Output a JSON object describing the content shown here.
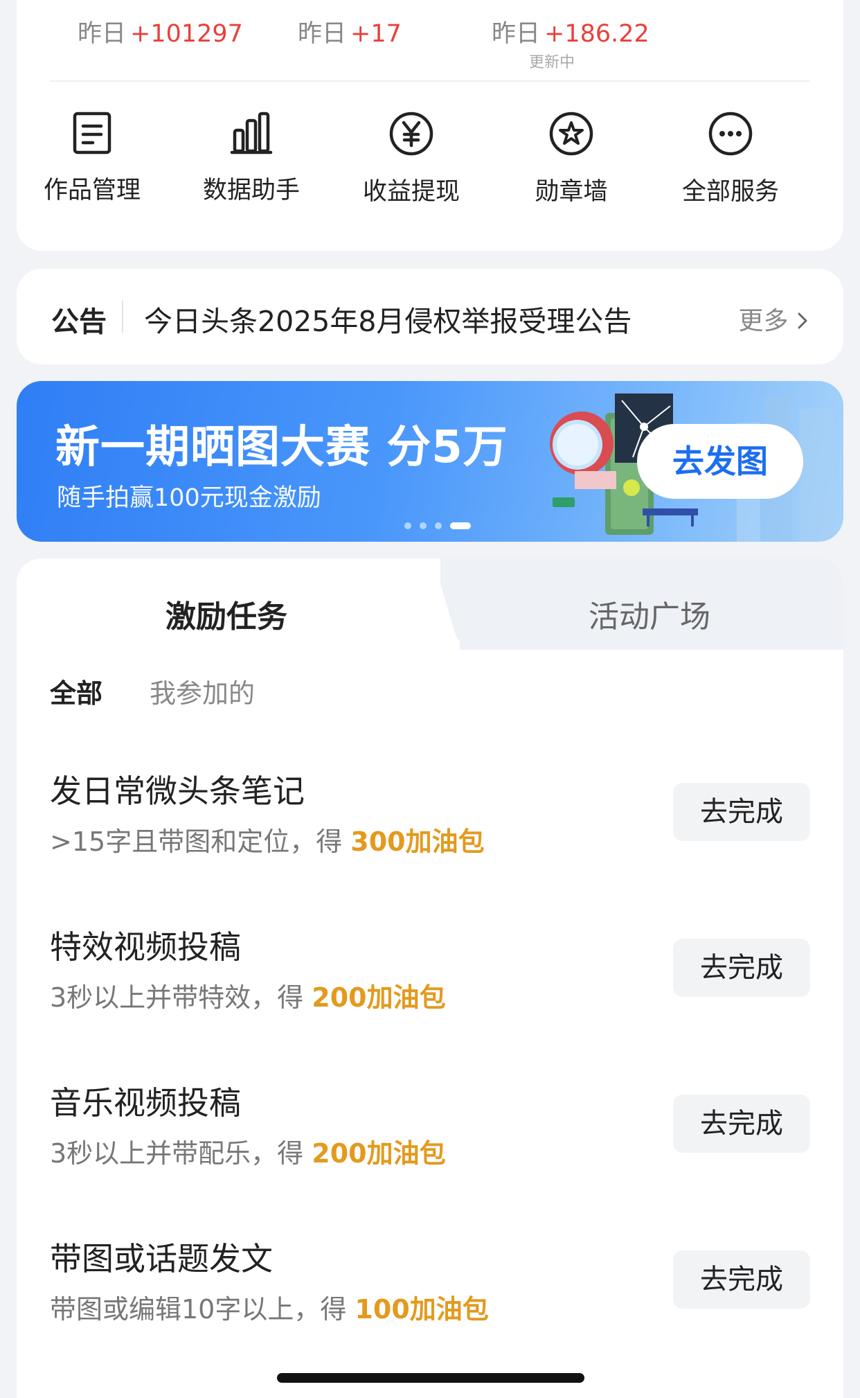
{
  "stats": [
    {
      "label": "昨日",
      "delta": "+101297",
      "note": ""
    },
    {
      "label": "昨日",
      "delta": "+17",
      "note": ""
    },
    {
      "label": "昨日",
      "delta": "+186.22",
      "note": "更新中"
    }
  ],
  "services": [
    {
      "label": "作品管理",
      "icon": "document-icon"
    },
    {
      "label": "数据助手",
      "icon": "bar-chart-icon"
    },
    {
      "label": "收益提现",
      "icon": "yen-icon"
    },
    {
      "label": "勋章墙",
      "icon": "medal-icon"
    },
    {
      "label": "全部服务",
      "icon": "more-icon"
    }
  ],
  "notice": {
    "tag": "公告",
    "text": "今日头条2025年8月侵权举报受理公告",
    "more": "更多"
  },
  "banner": {
    "title": "新一期晒图大赛 分5万",
    "subtitle": "随手拍赢100元现金激励",
    "cta": "去发图",
    "page_count": 4,
    "active_page": 4
  },
  "tabs": {
    "incentive": "激励任务",
    "square": "活动广场"
  },
  "filters": {
    "all": "全部",
    "mine": "我参加的"
  },
  "tasks": [
    {
      "title": "发日常微头条笔记",
      "desc": ">15字且带图和定位，得 ",
      "reward": "300加油包",
      "button": "去完成"
    },
    {
      "title": "特效视频投稿",
      "desc": "3秒以上并带特效，得 ",
      "reward": "200加油包",
      "button": "去完成"
    },
    {
      "title": "音乐视频投稿",
      "desc": "3秒以上并带配乐，得 ",
      "reward": "200加油包",
      "button": "去完成"
    },
    {
      "title": "带图或话题发文",
      "desc": "带图或编辑10字以上，得 ",
      "reward": "100加油包",
      "button": "去完成"
    }
  ],
  "colors": {
    "accent_red": "#e8403a",
    "reward_orange": "#e39a1e",
    "banner_blue": "#2f7ef5",
    "cta_text_blue": "#1c6ef2"
  }
}
